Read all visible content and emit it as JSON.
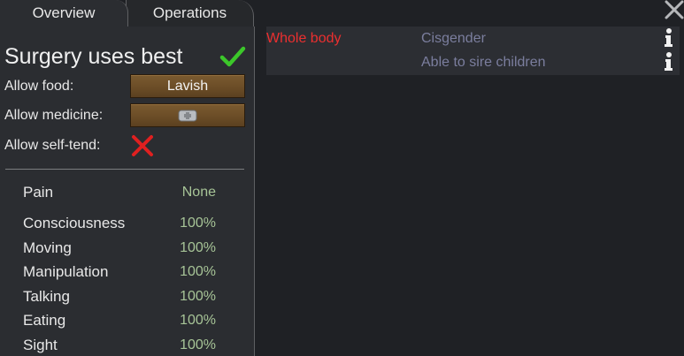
{
  "tabs": {
    "overview": "Overview",
    "operations": "Operations"
  },
  "panel": {
    "title": "Surgery uses best",
    "allow_food_label": "Allow food:",
    "allow_food_value": "Lavish",
    "allow_medicine_label": "Allow medicine:",
    "allow_self_tend_label": "Allow self-tend:"
  },
  "capacities": [
    {
      "name": "Pain",
      "value": "None"
    },
    {
      "name": "Consciousness",
      "value": "100%"
    },
    {
      "name": "Moving",
      "value": "100%"
    },
    {
      "name": "Manipulation",
      "value": "100%"
    },
    {
      "name": "Talking",
      "value": "100%"
    },
    {
      "name": "Eating",
      "value": "100%"
    },
    {
      "name": "Sight",
      "value": "100%"
    }
  ],
  "health": {
    "part": "Whole body",
    "hediffs": [
      "Cisgender",
      "Able to sire children"
    ]
  },
  "colors": {
    "part_red": "#ec2f2f",
    "hediff_purple": "#7b7e9e",
    "value_green": "#a7c497",
    "check_green": "#3cc72a",
    "x_red": "#e02020"
  },
  "icons": {
    "check": "check-icon",
    "cross": "x-icon",
    "medicine": "medicine-kit-icon",
    "info": "info-icon",
    "close": "close-icon"
  }
}
